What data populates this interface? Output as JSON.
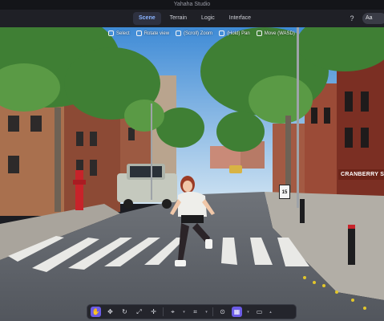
{
  "window": {
    "title": "Yahaha Studio"
  },
  "header": {
    "tabs": [
      {
        "label": "Scene",
        "active": true
      },
      {
        "label": "Terrain",
        "active": false
      },
      {
        "label": "Logic",
        "active": false
      },
      {
        "label": "Interface",
        "active": false
      }
    ],
    "help_icon": "question-circle-icon",
    "account_label": "Aa"
  },
  "viewport": {
    "hints": [
      {
        "label": "Select",
        "icon": "cursor-icon"
      },
      {
        "label": "Rotate view",
        "icon": "rotate-icon"
      },
      {
        "label": "(Scroll) Zoom",
        "icon": "mouse-scroll-icon"
      },
      {
        "label": "(Hold) Pan",
        "icon": "hand-icon"
      },
      {
        "label": "Move (WASD)",
        "icon": "keyboard-icon"
      }
    ],
    "street_sign": "CRANBERRY S",
    "speed_sign": "15"
  },
  "toolbar": {
    "tools": [
      {
        "name": "hand-tool",
        "icon": "hand-icon",
        "active": true
      },
      {
        "name": "move-tool",
        "icon": "move-icon",
        "active": false
      },
      {
        "name": "rotate-tool",
        "icon": "rotate-icon",
        "active": false
      },
      {
        "name": "scale-tool",
        "icon": "scale-icon",
        "active": false
      },
      {
        "name": "transform-tool",
        "icon": "transform-icon",
        "active": false
      },
      {
        "name": "pivot-tool",
        "icon": "pivot-icon",
        "active": false
      },
      {
        "name": "snap-tool",
        "icon": "snap-icon",
        "active": false
      },
      {
        "name": "camera-tool",
        "icon": "camera-icon",
        "active": false
      },
      {
        "name": "grid-tool",
        "icon": "grid-icon",
        "active": true
      },
      {
        "name": "video-tool",
        "icon": "video-icon",
        "active": false
      }
    ]
  },
  "colors": {
    "accent": "#6c5ce7",
    "tab_active": "#8ab4ff",
    "sign_red": "#6b2418"
  }
}
